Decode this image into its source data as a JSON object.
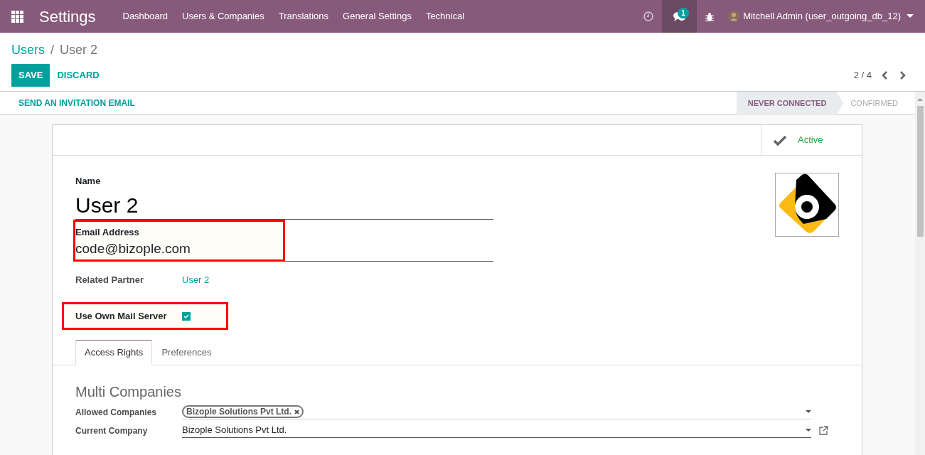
{
  "navbar": {
    "brand": "Settings",
    "menu": [
      "Dashboard",
      "Users & Companies",
      "Translations",
      "General Settings",
      "Technical"
    ],
    "messages_badge": "1",
    "user": "Mitchell Admin (user_outgoing_db_12)"
  },
  "breadcrumb": {
    "items": [
      "Users",
      "User 2"
    ],
    "separator": "/"
  },
  "buttons": [
    {
      "label": "SAVE",
      "kind": "primary"
    },
    {
      "label": "DISCARD",
      "kind": "link"
    }
  ],
  "pager": "2 / 4",
  "header_buttons": [
    "SEND AN INVITATION EMAIL"
  ],
  "statuses": [
    {
      "label": "NEVER CONNECTED",
      "selected": true
    },
    {
      "label": "CONFIRMED",
      "selected": false
    }
  ],
  "active_toggle": {
    "label": "Active",
    "on": true
  },
  "form": {
    "name": {
      "label": "Name",
      "value": "User 2"
    },
    "email": {
      "label": "Email Address",
      "value": "code@bizople.com",
      "highlighted": true
    },
    "related_partner": {
      "label": "Related Partner",
      "value": "User 2"
    },
    "own_mail_server": {
      "label": "Use Own Mail Server",
      "checked": true,
      "highlighted": true
    }
  },
  "tabs": [
    {
      "label": "Access Rights",
      "selected": true
    },
    {
      "label": "Preferences",
      "selected": false
    }
  ],
  "section": {
    "title": "Multi Companies",
    "fields": [
      {
        "label": "Allowed Companies",
        "kind": "tags",
        "tags": [
          "Bizople Solutions Pvt Ltd."
        ]
      },
      {
        "label": "Current Company",
        "kind": "select",
        "value": "Bizople Solutions Pvt Ltd."
      }
    ]
  }
}
